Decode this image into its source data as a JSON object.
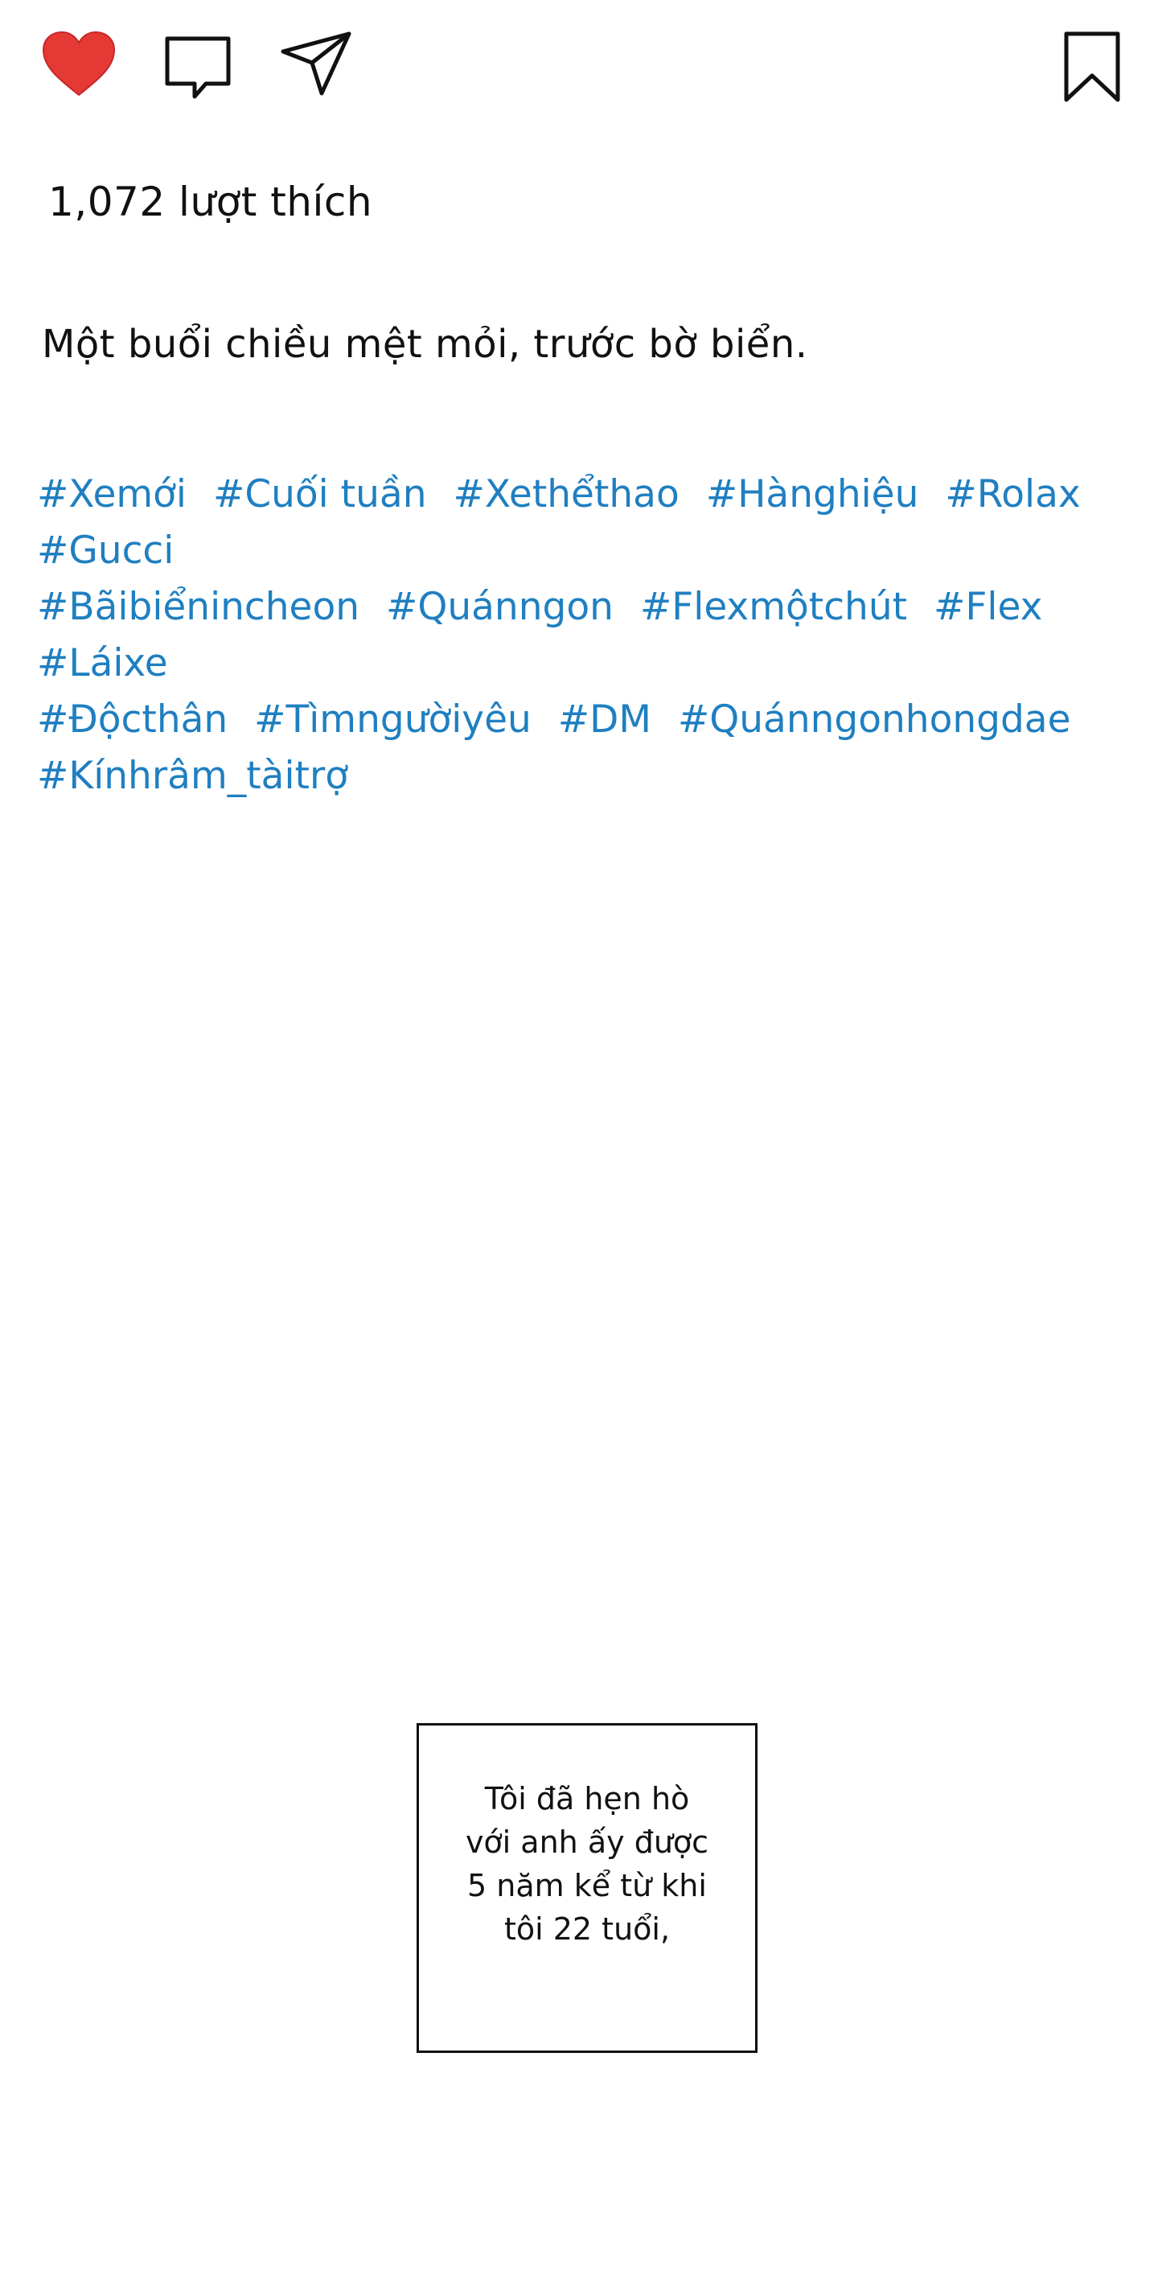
{
  "post": {
    "actions": {
      "like_icon": "heart-filled-icon",
      "like_color": "#e53935",
      "comment_icon": "comment-icon",
      "share_icon": "send-icon",
      "save_icon": "bookmark-icon"
    },
    "likes_text": "1,072 lượt thích",
    "caption": "Một buổi chiều mệt mỏi, trước bờ biển.",
    "hashtag_color": "#1f7fc1",
    "hashtags": [
      "#Xemới",
      "#Cuối tuần",
      "#Xethểthao",
      "#Hànghiệu",
      "#Rolax",
      "#Gucci",
      "#Bãibiểnincheon",
      "#Quánngon",
      "#Flexmộtchút",
      "#Flex",
      "#Láixe",
      "#Độcthân",
      "#Tìmngườiyêu",
      "#DM",
      "#Quánngonhongdae",
      "#Kínhrâm_tàitrợ"
    ]
  },
  "narration": {
    "lines": [
      "Tôi đã hẹn hò",
      "với anh ấy được",
      "5 năm kể từ khi",
      "tôi 22 tuổi,"
    ]
  }
}
